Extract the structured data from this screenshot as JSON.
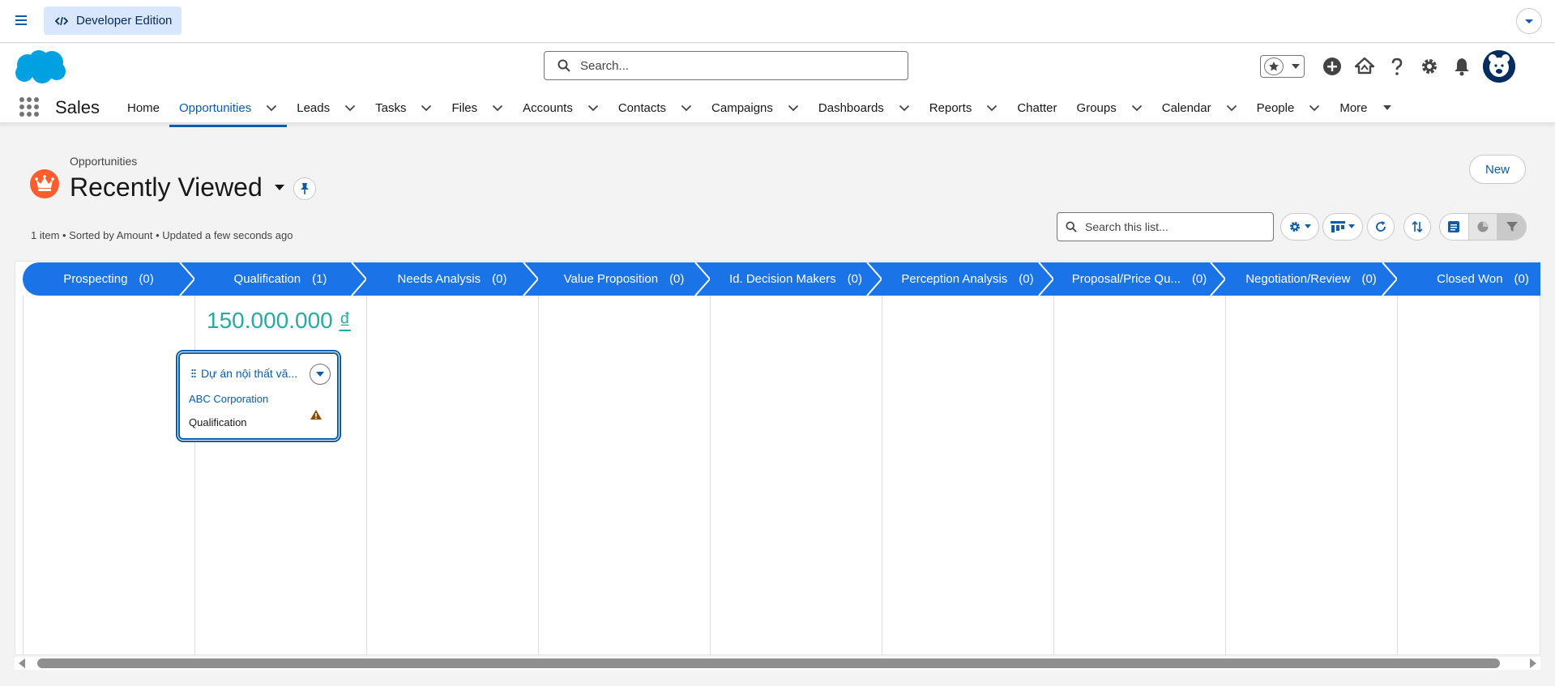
{
  "topbar": {
    "edition_label": "Developer Edition"
  },
  "header": {
    "search_placeholder": "Search..."
  },
  "nav": {
    "app_name": "Sales",
    "items": [
      {
        "label": "Home",
        "has_menu": false,
        "active": false
      },
      {
        "label": "Opportunities",
        "has_menu": true,
        "active": true
      },
      {
        "label": "Leads",
        "has_menu": true,
        "active": false
      },
      {
        "label": "Tasks",
        "has_menu": true,
        "active": false
      },
      {
        "label": "Files",
        "has_menu": true,
        "active": false
      },
      {
        "label": "Accounts",
        "has_menu": true,
        "active": false
      },
      {
        "label": "Contacts",
        "has_menu": true,
        "active": false
      },
      {
        "label": "Campaigns",
        "has_menu": true,
        "active": false
      },
      {
        "label": "Dashboards",
        "has_menu": true,
        "active": false
      },
      {
        "label": "Reports",
        "has_menu": true,
        "active": false
      },
      {
        "label": "Chatter",
        "has_menu": false,
        "active": false
      },
      {
        "label": "Groups",
        "has_menu": true,
        "active": false
      },
      {
        "label": "Calendar",
        "has_menu": true,
        "active": false
      },
      {
        "label": "People",
        "has_menu": true,
        "active": false
      },
      {
        "label": "More",
        "has_menu": true,
        "active": false
      }
    ]
  },
  "page": {
    "breadcrumb": "Opportunities",
    "title": "Recently Viewed",
    "new_label": "New",
    "meta": "1 item • Sorted by Amount • Updated a few seconds ago",
    "list_search_placeholder": "Search this list..."
  },
  "kanban": {
    "stages": [
      {
        "name": "Prospecting",
        "count": "(0)"
      },
      {
        "name": "Qualification",
        "count": "(1)"
      },
      {
        "name": "Needs Analysis",
        "count": "(0)"
      },
      {
        "name": "Value Proposition",
        "count": "(0)"
      },
      {
        "name": "Id. Decision Makers",
        "count": "(0)"
      },
      {
        "name": "Perception Analysis",
        "count": "(0)"
      },
      {
        "name": "Proposal/Price Qu...",
        "count": "(0)"
      },
      {
        "name": "Negotiation/Review",
        "count": "(0)"
      },
      {
        "name": "Closed Won",
        "count": "(0)"
      }
    ],
    "qualification_total": "150.000.000",
    "currency_symbol": "₫",
    "card": {
      "title": "Dự án nội thất vă...",
      "account": "ABC Corporation",
      "stage": "Qualification"
    }
  },
  "colors": {
    "brand_blue": "#0b5cab",
    "stage_blue": "#1b73e8",
    "total_teal": "#27a9a4",
    "object_icon": "#ff5d2d"
  }
}
